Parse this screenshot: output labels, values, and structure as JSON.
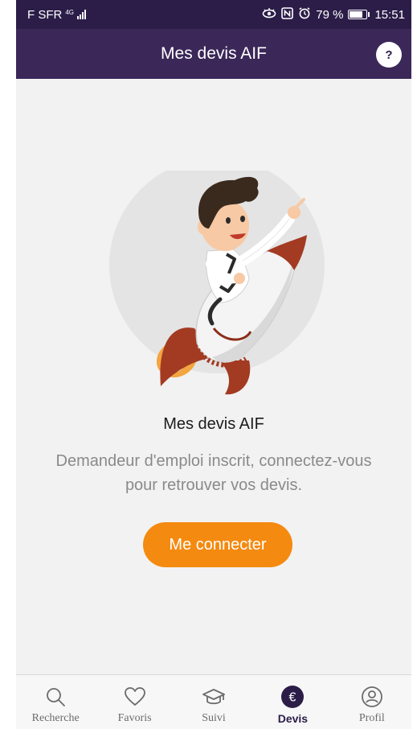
{
  "status_bar": {
    "carrier": "F SFR",
    "network_badge": "4G",
    "battery_percent": "79 %",
    "battery_level": 0.79,
    "time": "15:51",
    "icons": [
      "eye-icon",
      "nfc-icon",
      "alarm-icon"
    ]
  },
  "app_bar": {
    "title": "Mes devis AIF",
    "help_label": "?"
  },
  "empty_state": {
    "title": "Mes devis AIF",
    "description_line1": "Demandeur d'emploi inscrit, connectez-vous",
    "description_line2": "pour retrouver vos devis.",
    "button_label": "Me connecter"
  },
  "bottom_nav": {
    "items": [
      {
        "label": "Recherche",
        "icon": "search-icon",
        "active": false
      },
      {
        "label": "Favoris",
        "icon": "heart-icon",
        "active": false
      },
      {
        "label": "Suivi",
        "icon": "graduation-cap-icon",
        "active": false
      },
      {
        "label": "Devis",
        "icon": "euro-icon",
        "active": true
      },
      {
        "label": "Profil",
        "icon": "user-icon",
        "active": false
      }
    ]
  },
  "colors": {
    "header": "#3b2758",
    "status_bar": "#2b1d48",
    "accent": "#f48a10",
    "rocket": "#a33a22"
  }
}
